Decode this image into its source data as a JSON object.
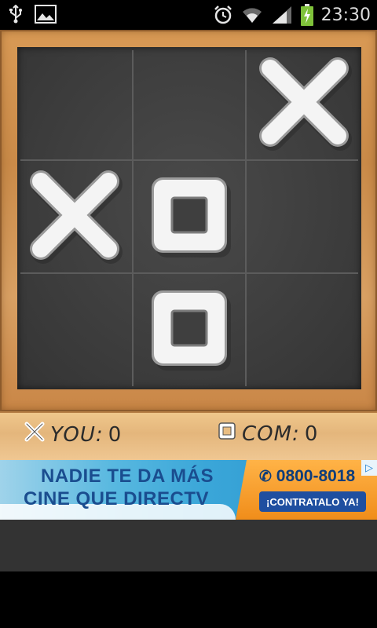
{
  "status_bar": {
    "time": "23:30",
    "left_icons": [
      "usb-icon",
      "image-icon"
    ],
    "right_icons": [
      "alarm-icon",
      "wifi-icon",
      "signal-icon",
      "battery-charging-icon"
    ]
  },
  "game": {
    "cells": [
      "",
      "",
      "X",
      "X",
      "O",
      "",
      "",
      "O",
      ""
    ],
    "colors": {
      "board": "#3f3f3f",
      "frame": "#d39a58",
      "mark": "#ffffff"
    }
  },
  "scores": {
    "player": {
      "label": "YOU:",
      "value": "0",
      "icon": "x-icon"
    },
    "computer": {
      "label": "COM:",
      "value": "0",
      "icon": "square-icon"
    }
  },
  "ad": {
    "line1": "NADIE TE DA MÁS",
    "line2": "CINE QUE DIRECTV",
    "phone": "0800-8018",
    "cta": "¡CONTRATALO YA!",
    "badge_icon": "adchoices-icon"
  }
}
